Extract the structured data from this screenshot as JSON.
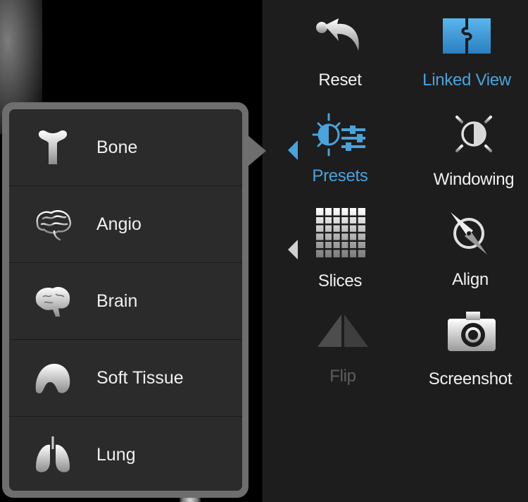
{
  "toolbar": {
    "reset_label": "Reset",
    "linked_view_label": "Linked View",
    "presets_label": "Presets",
    "windowing_label": "Windowing",
    "slices_label": "Slices",
    "align_label": "Align",
    "flip_label": "Flip",
    "screenshot_label": "Screenshot"
  },
  "presets": [
    {
      "label": "Bone",
      "icon": "bone-icon"
    },
    {
      "label": "Angio",
      "icon": "angio-icon"
    },
    {
      "label": "Brain",
      "icon": "brain-icon"
    },
    {
      "label": "Soft Tissue",
      "icon": "soft-tissue-icon"
    },
    {
      "label": "Lung",
      "icon": "lung-icon"
    }
  ],
  "colors": {
    "accent": "#4aa3dc",
    "panel_bg": "#1d1d1d",
    "menu_item_bg": "#2b2b2b",
    "text": "#f1f1f1",
    "disabled": "#5d5d5d"
  }
}
